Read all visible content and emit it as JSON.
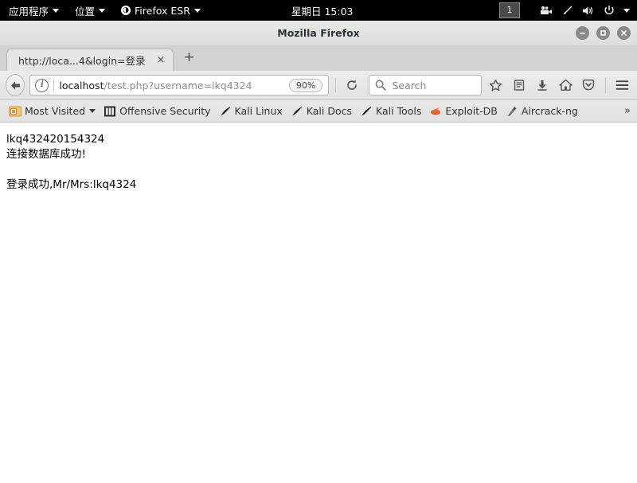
{
  "desktop_panel": {
    "applications_menu": "应用程序",
    "places_menu": "位置",
    "firefox_menu": "Firefox ESR",
    "clock": "星期日 15:03",
    "workspace": "1",
    "tray_icons": [
      "camera-icon",
      "network-icon",
      "volume-icon",
      "power-icon",
      "chevron-down-icon"
    ]
  },
  "window": {
    "title": "Mozilla Firefox",
    "controls": {
      "minimize": "−",
      "maximize": "□",
      "close": "×"
    }
  },
  "tabs": {
    "items": [
      {
        "title": "http://loca...4&login=登录",
        "close": "×"
      }
    ],
    "new_tab": "+"
  },
  "toolbar": {
    "back": "←",
    "identity": "i",
    "url_host": "localhost",
    "url_path": "/test.php?username=lkq4324",
    "zoom_level": "90%",
    "reload": "⟳",
    "search_placeholder": "Search",
    "bookmark_star": "star-icon",
    "library": "library-icon",
    "downloads": "downloads-icon",
    "home": "home-icon",
    "pocket": "pocket-icon",
    "menu": "hamburger-menu-icon"
  },
  "bookmarks": {
    "items": [
      {
        "label": "Most Visited",
        "icon": "most-visited-icon",
        "has_caret": true
      },
      {
        "label": "Offensive Security",
        "icon": "offensive-security-icon",
        "has_caret": false
      },
      {
        "label": "Kali Linux",
        "icon": "kali-dragon-icon",
        "has_caret": false
      },
      {
        "label": "Kali Docs",
        "icon": "kali-dragon-icon",
        "has_caret": false
      },
      {
        "label": "Kali Tools",
        "icon": "kali-dragon-icon",
        "has_caret": false
      },
      {
        "label": "Exploit-DB",
        "icon": "exploit-db-icon",
        "has_caret": false
      },
      {
        "label": "Aircrack-ng",
        "icon": "aircrack-ng-icon",
        "has_caret": false
      }
    ],
    "overflow": "»"
  },
  "content": {
    "line1": "lkq432420154324",
    "line2": "连接数据库成功!",
    "line3": "登录成功,Mr/Mrs:lkq4324"
  },
  "colors": {
    "panel_bg": "#000000",
    "chrome_bg": "#e5e5e4",
    "tabstrip_bg": "#d2d2d2",
    "page_bg": "#ffffff",
    "text": "#000000",
    "url_dim": "#8e8e8e"
  }
}
